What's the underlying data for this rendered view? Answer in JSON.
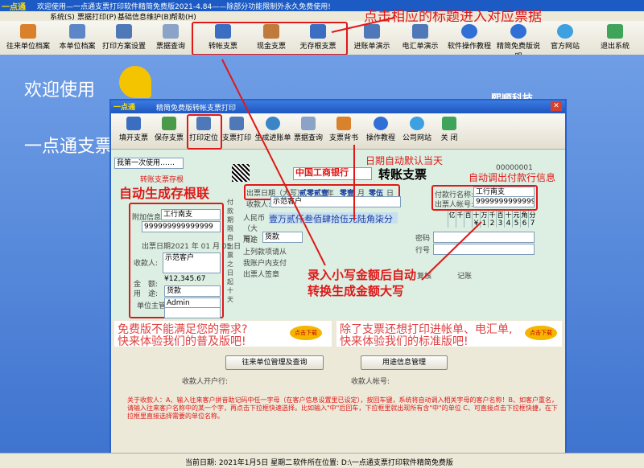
{
  "app": {
    "logo": "一点通",
    "title": "欢迎使用—一点通支票打印软件精简免费版2021-4.84——除部分功能限制外永久免费使用!"
  },
  "menu": [
    "系统(S)",
    "票据打印(P)",
    "基础信息维护(B)",
    "帮助(H)"
  ],
  "toolbar": [
    "往来单位档案",
    "本单位档案",
    "打印方案设置",
    "票据查询",
    "转帐支票",
    "现金支票",
    "无存根支票",
    "进账单演示",
    "电汇单演示",
    "软件操作教程",
    "精简免费版说明",
    "官方网站",
    "退出系统"
  ],
  "annotations": {
    "top_hint": "点击相应的标题进入对应票据",
    "date_auto": "日期自动默认当天",
    "payer_auto": "自动调出付款行信息",
    "stub_auto": "自动生成存根联",
    "amount_auto_1": "录入小写金额后自动",
    "amount_auto_2": "转换生成金额大写"
  },
  "desktop": {
    "welcome": "欢迎使用",
    "brand": "一点通支票",
    "company": "熙顺科技"
  },
  "window2": {
    "logo": "一点通",
    "title": "精简免费版转帐支票打印",
    "toolbar": [
      "填开支票",
      "保存支票",
      "打印定位",
      "支票打印",
      "生成进账单",
      "票据查询",
      "支票背书",
      "操作教程",
      "公司网站",
      "关 闭"
    ]
  },
  "check": {
    "first_use": "我第一次使用……",
    "stub_title": "转账支票存根",
    "bank": "中国工商银行",
    "check_title": "转账支票",
    "check_no": "00000001",
    "date_label": "出票日期（大写）",
    "year": "贰零贰壹",
    "year_label": "年",
    "month": "零壹",
    "month_label": "月",
    "day": "零伍",
    "day_label": "日",
    "payee_label": "收款人:",
    "payee": "示范客户",
    "payer_bank_label": "付款行名称:",
    "payer_bank": "工行南支",
    "payer_acct_label": "出票人帐号:",
    "payer_acct": "999999999999999",
    "rmb_label": "人民币（大写）",
    "amount_upper": "壹万贰仟叁佰肆拾伍元陆角柒分",
    "digit_headers": [
      "亿",
      "千",
      "百",
      "十",
      "万",
      "千",
      "百",
      "十",
      "元",
      "角",
      "分"
    ],
    "digits": [
      "",
      "",
      "",
      "¥",
      "1",
      "2",
      "3",
      "4",
      "5",
      "6",
      "7"
    ],
    "side_text": "付款期限自出票之日起十天",
    "use_label": "用途",
    "use_value": "货款",
    "password_label": "密码",
    "line_no_label": "行号",
    "above_label": "上列款项请从",
    "account_label": "我账户内支付",
    "drawer_label": "出票人签章",
    "reviewer": "复核",
    "recorder": "记账",
    "stub": {
      "acct_info_label": "附加信息",
      "bank": "工行南支",
      "acct": "999999999999999",
      "date": "出票日期2021 年 01 月 05 日",
      "payee_label": "收款人:",
      "payee": "示范客户",
      "amount_label": "金　额:",
      "amount": "¥12,345.67",
      "use_label": "用　途:",
      "use": "货款",
      "manager_label": "单位主管",
      "manager": "Admin"
    }
  },
  "ads": {
    "left_1": "免费版不能满足您的需求?",
    "left_2": "快来体验我们的普及版吧!",
    "right_1": "除了支票还想打印进帐单、电汇单,",
    "right_2": "快来体验我们的标准版吧!",
    "badge": "点击下载"
  },
  "buttons": {
    "manage_units": "往来单位管理及查询",
    "manage_use": "用途信息管理"
  },
  "fields": {
    "payee_bank": "收款人开户行:",
    "payee_acct": "收款人帐号:"
  },
  "hint": "关于收款人：A、输入往来客户拼音助记码中任一字母（在客户信息设置里已设定），按回车键，系统将自动调入相关字母的客户名称！B、如客户重名，请输入往来客户名称中的某一个字，再点击下拉框快速选择。比如输入\"中\"后回车，下拉框里就出现所有含\"中\"的单位 C、可直接点击下拉框快捷，在下拉框里直接选择需要的单位名称。",
  "status": {
    "date": "当前日期: 2021年1月5日 星期二",
    "path": "软件所在位置: D:\\一点通支票打印软件精简免费版"
  },
  "colors": {
    "accent": "#e01818",
    "title": "#1d56c0"
  }
}
